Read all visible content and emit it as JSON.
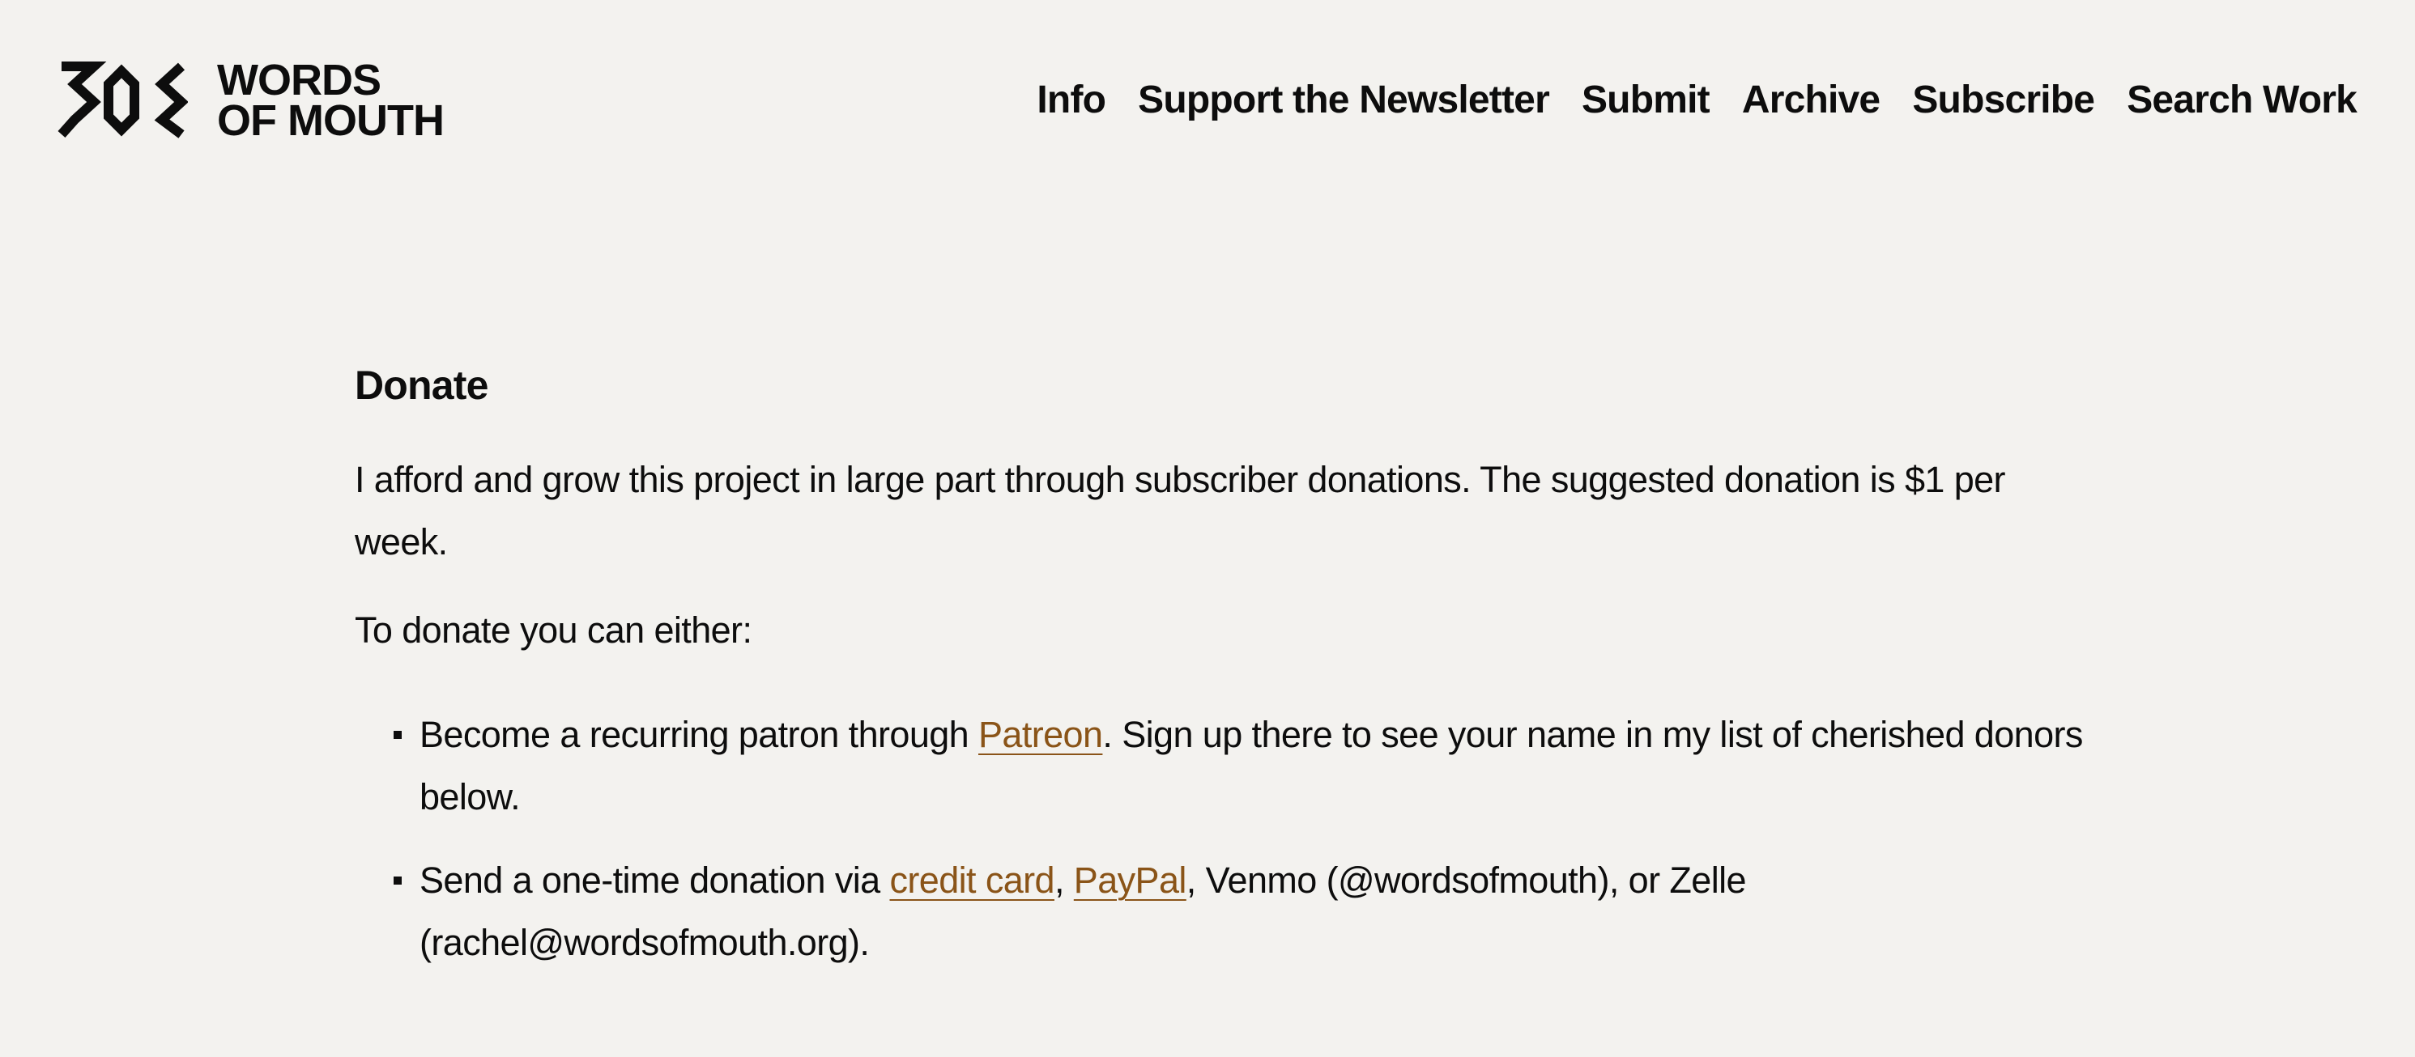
{
  "site": {
    "logo_line1": "WORDS",
    "logo_line2": "OF MOUTH"
  },
  "nav": {
    "items": [
      "Info",
      "Support the Newsletter",
      "Submit",
      "Archive",
      "Subscribe",
      "Search Work"
    ]
  },
  "main": {
    "title": "Donate",
    "para1": "I afford and grow this project in large part through subscriber donations. The suggested donation is $1 per week.",
    "para2": "To donate you can either:",
    "bullets": [
      {
        "prefix": "Become a recurring patron through ",
        "link": "Patreon",
        "suffix": ". Sign up there to see your name in my list of cherished donors below."
      },
      {
        "prefix": "Send a one-time donation via ",
        "link1": "credit card",
        "sep": ", ",
        "link2": "PayPal",
        "suffix": ", Venmo (@wordsofmouth), or Zelle (rachel@wordsofmouth.org)."
      }
    ]
  },
  "colors": {
    "background": "#f3f2ef",
    "text": "#0d0d0d",
    "link": "#8a5418"
  }
}
